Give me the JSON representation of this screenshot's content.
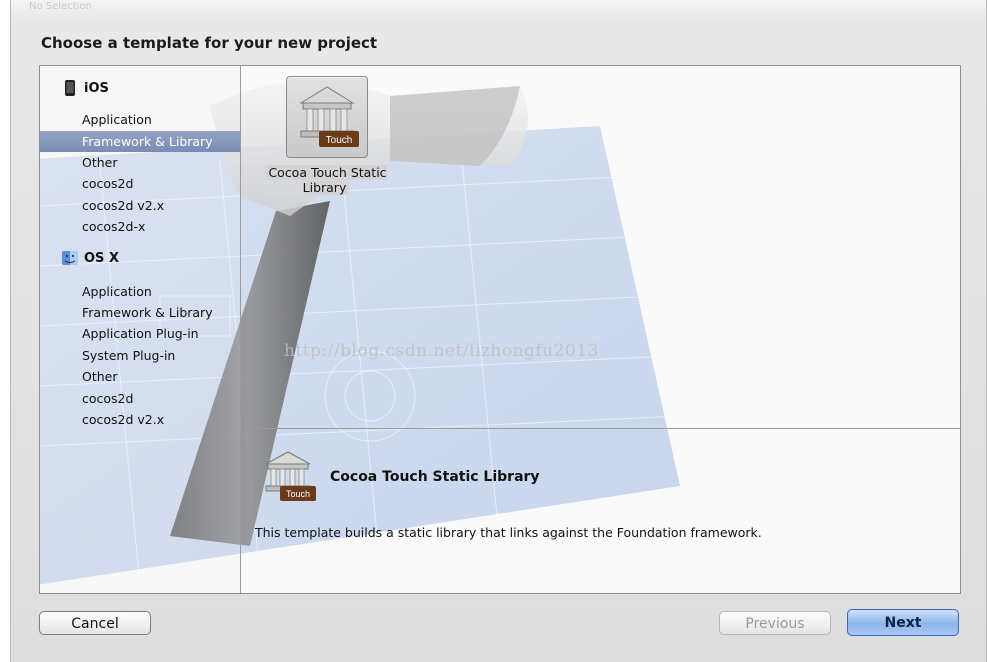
{
  "window": {
    "top_strip_text": "No Selection",
    "heading": "Choose a template for your new project"
  },
  "sidebar": {
    "groups": [
      {
        "title": "iOS",
        "icon": "iphone-icon",
        "items": [
          "Application",
          "Framework & Library",
          "Other",
          "cocos2d",
          "cocos2d v2.x",
          "cocos2d-x"
        ]
      },
      {
        "title": "OS X",
        "icon": "finder-icon",
        "items": [
          "Application",
          "Framework & Library",
          "Application Plug-in",
          "System Plug-in",
          "Other",
          "cocos2d",
          "cocos2d v2.x"
        ]
      }
    ],
    "selected": "iOS / Framework & Library"
  },
  "templates": [
    {
      "label": "Cocoa Touch Static Library",
      "badge": "Touch",
      "icon": "library-building-icon",
      "selected": true
    }
  ],
  "watermark": "http://blog.csdn.net/lizhongfu2013",
  "description": {
    "title": "Cocoa Touch Static Library",
    "badge": "Touch",
    "text": "This template builds a static library that links against the Foundation framework."
  },
  "buttons": {
    "cancel": "Cancel",
    "previous": "Previous",
    "next": "Next"
  },
  "colors": {
    "selection": "#8494bb",
    "next_button": "#9cc0ef",
    "touch_badge": "#6b3a1a"
  }
}
